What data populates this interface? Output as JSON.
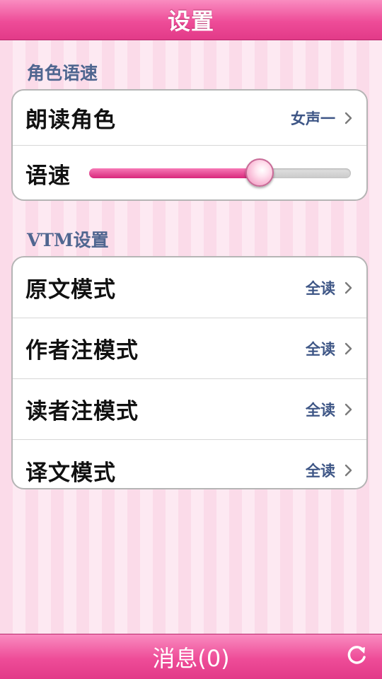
{
  "header": {
    "title": "设置"
  },
  "sections": {
    "role_speed": {
      "title": "角色语速",
      "reader_role": {
        "label": "朗读角色",
        "value": "女声一"
      },
      "speed": {
        "label": "语速",
        "level": 0.65
      }
    },
    "vtm": {
      "title": "VTM设置",
      "rows": [
        {
          "label": "原文模式",
          "value": "全读"
        },
        {
          "label": "作者注模式",
          "value": "全读"
        },
        {
          "label": "读者注模式",
          "value": "全读"
        },
        {
          "label": "译文模式",
          "value": "全读"
        }
      ]
    }
  },
  "footer": {
    "message": "消息(0)",
    "refresh_icon": "refresh-icon"
  },
  "colors": {
    "accent": "#e23a88",
    "section_text": "#4f6690",
    "value_text": "#3e5686"
  }
}
